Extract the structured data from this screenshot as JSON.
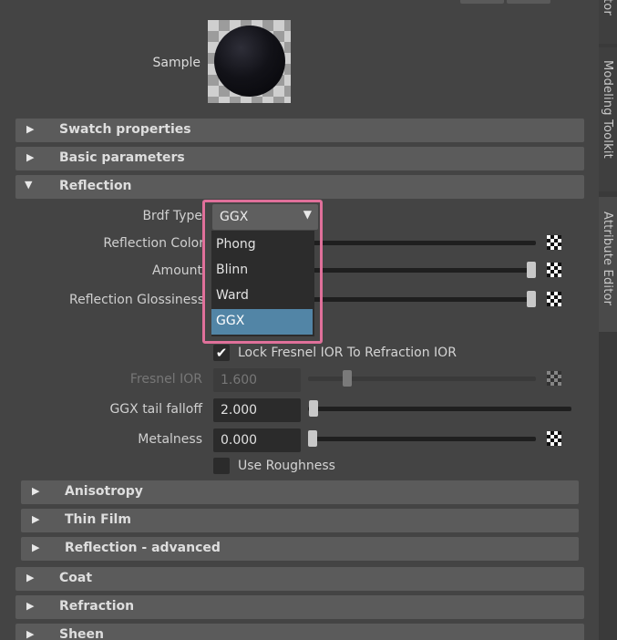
{
  "right_tabs": {
    "top_tab": "tor",
    "modeling_toolkit": "Modeling Toolkit",
    "attribute_editor": "Attribute Editor"
  },
  "sample": {
    "label": "Sample"
  },
  "sections": {
    "swatch_properties": "Swatch properties",
    "basic_parameters": "Basic parameters",
    "reflection": "Reflection",
    "anisotropy": "Anisotropy",
    "thin_film": "Thin Film",
    "reflection_advanced": "Reflection - advanced",
    "coat": "Coat",
    "refraction": "Refraction",
    "sheen": "Sheen"
  },
  "reflection": {
    "brdf_type_label": "Brdf Type",
    "brdf_type_value": "GGX",
    "brdf_options": [
      "Phong",
      "Blinn",
      "Ward",
      "GGX"
    ],
    "brdf_selected_index": 3,
    "reflection_color_label": "Reflection Color",
    "amount_label": "Amount",
    "reflection_glossiness_label": "Reflection Glossiness",
    "lock_fresnel_label": "Lock Fresnel IOR To Refraction IOR",
    "lock_fresnel_checked": true,
    "fresnel_ior_label": "Fresnel IOR",
    "fresnel_ior_value": "1.600",
    "ggx_tail_label": "GGX tail falloff",
    "ggx_tail_value": "2.000",
    "metalness_label": "Metalness",
    "metalness_value": "0.000",
    "use_roughness_label": "Use Roughness",
    "use_roughness_checked": false
  },
  "colors": {
    "highlight_border": "#e0709a",
    "selected_option": "#5285a6",
    "section_header": "#5b5b5b",
    "panel_bg": "#444444"
  },
  "icons": {
    "expand": "triangle-right",
    "collapse": "triangle-down",
    "map_button": "checker-map",
    "dropdown": "chevron-down"
  }
}
